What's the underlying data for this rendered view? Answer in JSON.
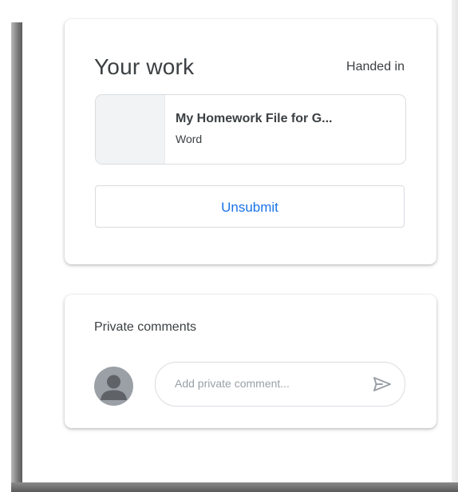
{
  "your_work": {
    "title": "Your work",
    "status": "Handed in",
    "attachment": {
      "name": "My Homework File for G...",
      "type": "Word"
    },
    "unsubmit_label": "Unsubmit"
  },
  "private_comments": {
    "title": "Private comments",
    "input_placeholder": "Add private comment...",
    "send_icon": "send-icon",
    "avatar_icon": "person-icon"
  },
  "colors": {
    "accent": "#1a73e8",
    "text": "#3c4043",
    "border": "#dadce0",
    "avatar": "#9aa0a6"
  }
}
